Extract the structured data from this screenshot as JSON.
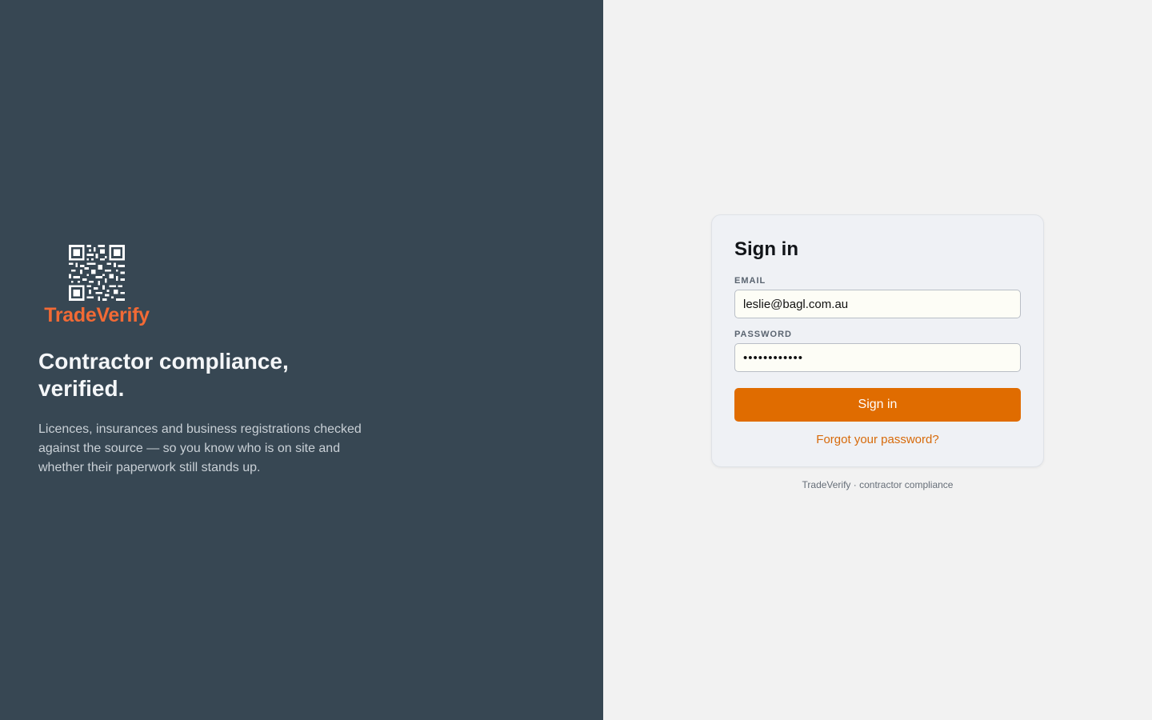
{
  "brand": {
    "logo_word": "TradeVerify",
    "logo_icon": "qr-code-icon",
    "headline": "Contractor compliance, verified.",
    "blurb": "Licences, insurances and business registrations checked against the source — so you know who is on site and whether their paperwork still stands up."
  },
  "signin": {
    "title": "Sign in",
    "email_label": "EMAIL",
    "email_value": "leslie@bagl.com.au",
    "password_label": "PASSWORD",
    "password_value": "••••••••••••",
    "button_label": "Sign in",
    "forgot_label": "Forgot your password?"
  },
  "footer": {
    "text": "TradeVerify · contractor compliance"
  },
  "colors": {
    "brand_panel_bg": "#374753",
    "accent": "#e06c00",
    "logo": "#f26a35",
    "form_bg": "#f2f2f2"
  }
}
